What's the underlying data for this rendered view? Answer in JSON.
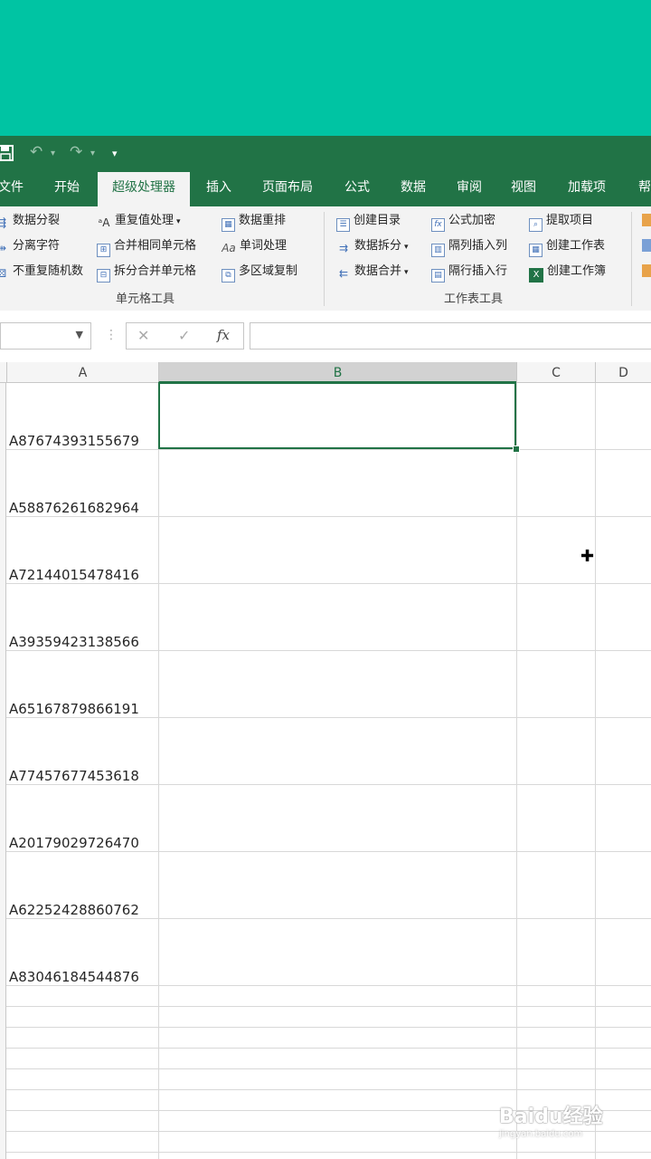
{
  "quick_access": {
    "save_icon": "save-icon",
    "undo_icon": "undo-icon",
    "redo_icon": "redo-icon",
    "customize_icon": "customize-qat-icon"
  },
  "tabs": [
    {
      "label": "文件"
    },
    {
      "label": "开始"
    },
    {
      "label": "超级处理器",
      "active": true
    },
    {
      "label": "插入"
    },
    {
      "label": "页面布局"
    },
    {
      "label": "公式"
    },
    {
      "label": "数据"
    },
    {
      "label": "审阅"
    },
    {
      "label": "视图"
    },
    {
      "label": "加载项"
    },
    {
      "label": "帮助"
    }
  ],
  "ribbon": {
    "group1": {
      "label": "单元格工具",
      "items": [
        "数据分裂",
        "分离字符",
        "不重复随机数",
        "重复值处理",
        "合并相同单元格",
        "拆分合并单元格",
        "数据重排",
        "单词处理",
        "多区域复制"
      ]
    },
    "group2": {
      "label": "工作表工具",
      "items": [
        "创建目录",
        "数据拆分",
        "数据合并",
        "公式加密",
        "隔列插入列",
        "隔行插入行",
        "提取项目",
        "创建工作表",
        "创建工作簿"
      ]
    }
  },
  "formula_bar": {
    "cancel": "✕",
    "enter": "✓",
    "fx": "fx",
    "content": ""
  },
  "columns": [
    "A",
    "B",
    "C",
    "D"
  ],
  "selected_cell": "B1",
  "cells_A": [
    "A87674393155679",
    "A58876261682964",
    "A72144015478416",
    "A39359423138566",
    "A65167879866191",
    "A77457677453618",
    "A20179029726470",
    "A62252428860762",
    "A83046184544876"
  ],
  "watermark": {
    "brand": "Baidu经验",
    "url": "jingyan.baidu.com"
  },
  "colors": {
    "accent": "#217346",
    "top_band": "#00c4a3"
  }
}
